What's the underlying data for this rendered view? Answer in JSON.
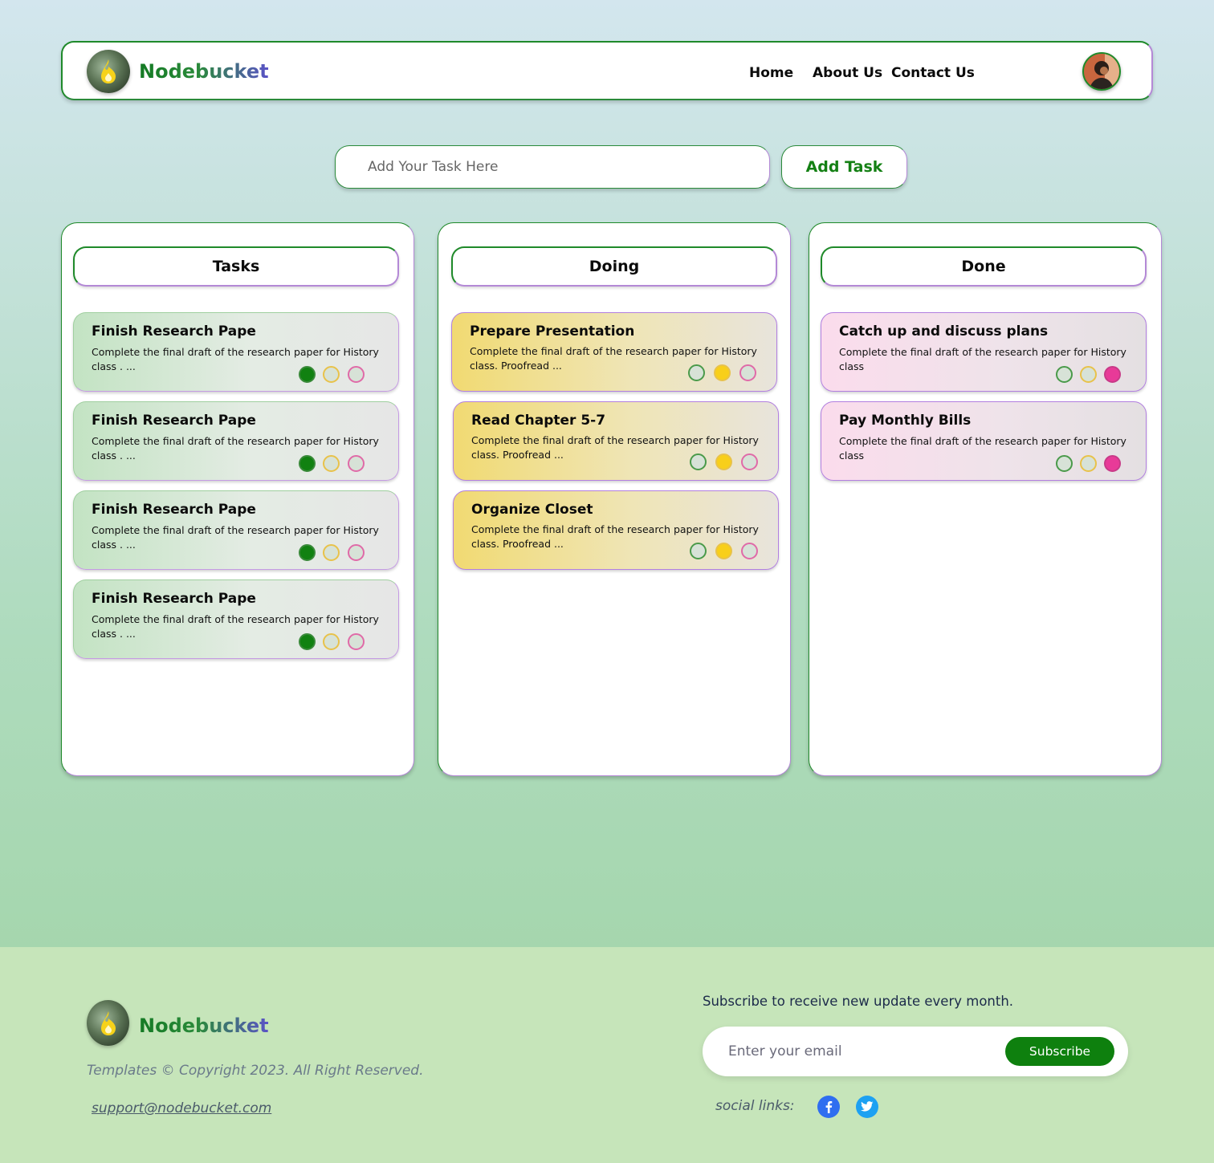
{
  "colors": {
    "brand_green": "#148014",
    "brand_purple": "#5b52c8",
    "done_dot": "#118111",
    "doing_dot": "#f8cf1a",
    "pending_dot": "#e83a98",
    "facebook": "#2f6ef0",
    "twitter": "#1da1f2"
  },
  "header": {
    "brand": "Nodebucket",
    "logo_icon": "flame-icon",
    "nav": [
      "Home",
      "About Us",
      "Contact Us"
    ],
    "avatar_icon": "user-avatar"
  },
  "add_task": {
    "placeholder": "Add Your Task Here",
    "button": "Add Task"
  },
  "columns": [
    {
      "title": "Tasks",
      "cards": [
        {
          "title": "Finish Research Pape",
          "desc": "Complete the final draft of the research paper for History class . ...",
          "status": "green"
        },
        {
          "title": "Finish Research Pape",
          "desc": "Complete the final draft of the research paper for History class . ...",
          "status": "green"
        },
        {
          "title": "Finish Research Pape",
          "desc": "Complete the final draft of the research paper for History class . ...",
          "status": "green"
        },
        {
          "title": "Finish Research Pape",
          "desc": "Complete the final draft of the research paper for History class . ...",
          "status": "green"
        }
      ]
    },
    {
      "title": "Doing",
      "cards": [
        {
          "title": "Prepare Presentation",
          "desc": "Complete the final draft of the research paper for History class. Proofread  ...",
          "status": "yellow"
        },
        {
          "title": "Read Chapter 5-7",
          "desc": "Complete the final draft of the research paper for History class. Proofread  ...",
          "status": "yellow"
        },
        {
          "title": "Organize Closet",
          "desc": "Complete the final draft of the research paper for History class. Proofread  ...",
          "status": "yellow"
        }
      ]
    },
    {
      "title": "Done",
      "cards": [
        {
          "title": "Catch up and discuss plans",
          "desc": "Complete the final draft of the research paper for History class",
          "status": "pink"
        },
        {
          "title": "Pay Monthly Bills",
          "desc": "Complete the final draft of the research paper for History class",
          "status": "pink"
        }
      ]
    }
  ],
  "footer": {
    "brand": "Nodebucket",
    "copyright": "Templates © Copyright 2023. All Right Reserved.",
    "support": "support@nodebucket.com",
    "subscribe_text": "Subscribe to receive new update every month.",
    "email_placeholder": "Enter your email",
    "subscribe_button": "Subscribe",
    "social_label": "social links:",
    "social_icons": [
      "facebook-icon",
      "twitter-icon"
    ]
  }
}
